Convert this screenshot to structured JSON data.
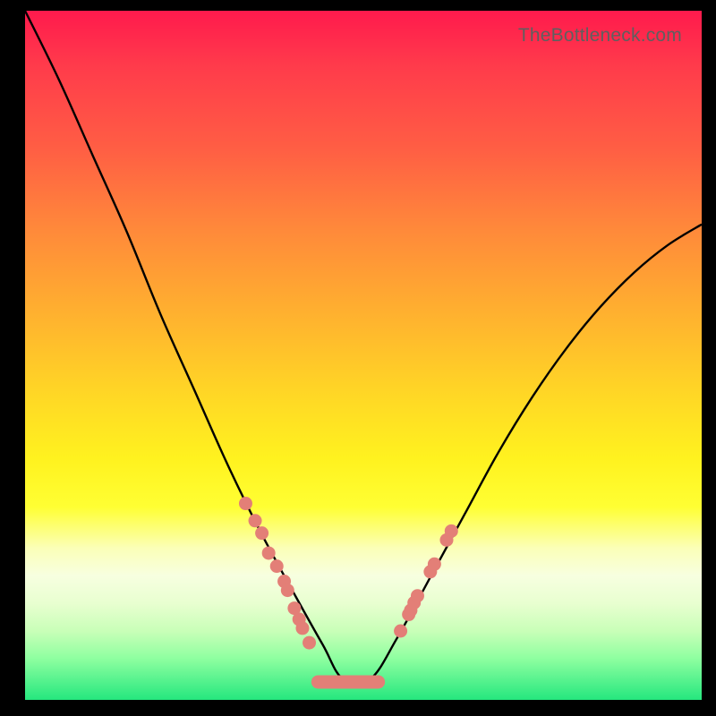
{
  "attribution": "TheBottleneck.com",
  "colors": {
    "background": "#000000",
    "curve": "#000000",
    "marker": "#e37f77",
    "gradient_top": "#ff1a4d",
    "gradient_bottom": "#25e77e"
  },
  "chart_data": {
    "type": "line",
    "title": "",
    "xlabel": "",
    "ylabel": "",
    "xlim": [
      0,
      100
    ],
    "ylim": [
      0,
      100
    ],
    "series": [
      {
        "name": "bottleneck-curve",
        "x": [
          0,
          5,
          10,
          15,
          20,
          25,
          30,
          35,
          40,
          44,
          47,
          51,
          55,
          60,
          65,
          70,
          75,
          80,
          85,
          90,
          95,
          100
        ],
        "values": [
          100,
          90,
          79,
          68,
          56,
          45,
          34,
          24,
          15,
          8,
          3,
          3,
          9,
          18,
          27,
          36,
          44,
          51,
          57,
          62,
          66,
          69
        ]
      }
    ],
    "markers_left": {
      "name": "threshold-markers-left",
      "x": [
        32.6,
        34.0,
        35.0,
        36.0,
        37.2,
        38.3,
        38.8,
        39.8,
        40.5,
        41.0,
        42.0
      ],
      "values": [
        28.5,
        26.0,
        24.2,
        21.3,
        19.4,
        17.2,
        15.9,
        13.3,
        11.7,
        10.4,
        8.3
      ]
    },
    "markers_right": {
      "name": "threshold-markers-right",
      "x": [
        55.5,
        56.7,
        57.0,
        57.5,
        58.0,
        59.9,
        60.5,
        62.3,
        63.0
      ],
      "values": [
        10.0,
        12.4,
        13.0,
        14.1,
        15.1,
        18.6,
        19.7,
        23.2,
        24.5
      ]
    },
    "flat_segment": {
      "name": "flat-bottom",
      "x_start": 43.3,
      "x_end": 52.2,
      "value": 2.6
    }
  }
}
